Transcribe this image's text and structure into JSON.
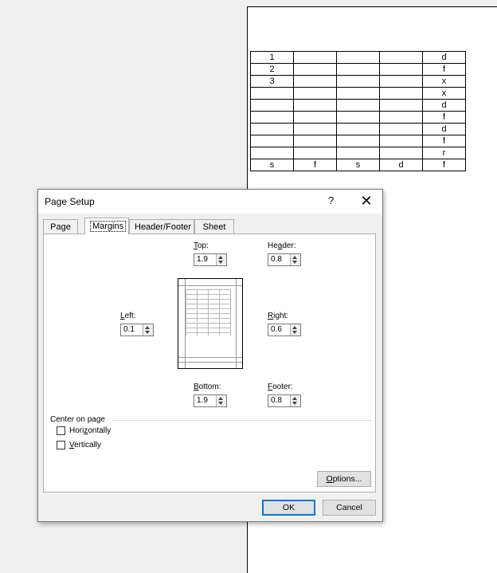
{
  "sheet": {
    "rows": [
      [
        "1",
        "",
        "",
        "",
        "d"
      ],
      [
        "2",
        "",
        "",
        "",
        "f"
      ],
      [
        "3",
        "",
        "",
        "",
        "x"
      ],
      [
        "",
        "",
        "",
        "",
        "x"
      ],
      [
        "",
        "",
        "",
        "",
        "d"
      ],
      [
        "",
        "",
        "",
        "",
        "f"
      ],
      [
        "",
        "",
        "",
        "",
        "d"
      ],
      [
        "",
        "",
        "",
        "",
        "f"
      ],
      [
        "",
        "",
        "",
        "",
        "r"
      ],
      [
        "s",
        "f",
        "s",
        "d",
        "f"
      ]
    ]
  },
  "dialog": {
    "title": "Page Setup",
    "help_label": "?",
    "close_label": "✕",
    "tabs": [
      {
        "label": "Page",
        "active": false
      },
      {
        "label": "Margins",
        "active": true
      },
      {
        "label": "Header/Footer",
        "active": false
      },
      {
        "label": "Sheet",
        "active": false
      }
    ],
    "margins": {
      "top": {
        "label_u": "T",
        "label_rest": "op:",
        "value": "1.9"
      },
      "header": {
        "label_pre": "He",
        "label_u": "a",
        "label_rest": "der:",
        "value": "0.8"
      },
      "left": {
        "label_u": "L",
        "label_rest": "eft:",
        "value": "0.1"
      },
      "right": {
        "label_u": "R",
        "label_rest": "ight:",
        "value": "0.6"
      },
      "bottom": {
        "label_u": "B",
        "label_rest": "ottom:",
        "value": "1.9"
      },
      "footer": {
        "label_u": "F",
        "label_rest": "ooter:",
        "value": "0.8"
      }
    },
    "center_on_page": {
      "title": "Center on page",
      "horizontally": {
        "label_pre": "Hori",
        "label_u": "z",
        "label_rest": "ontally",
        "checked": false
      },
      "vertically": {
        "label_u": "V",
        "label_rest": "ertically",
        "checked": false
      }
    },
    "options_button": {
      "label_u": "O",
      "label_rest": "ptions..."
    },
    "ok_label": "OK",
    "cancel_label": "Cancel"
  }
}
